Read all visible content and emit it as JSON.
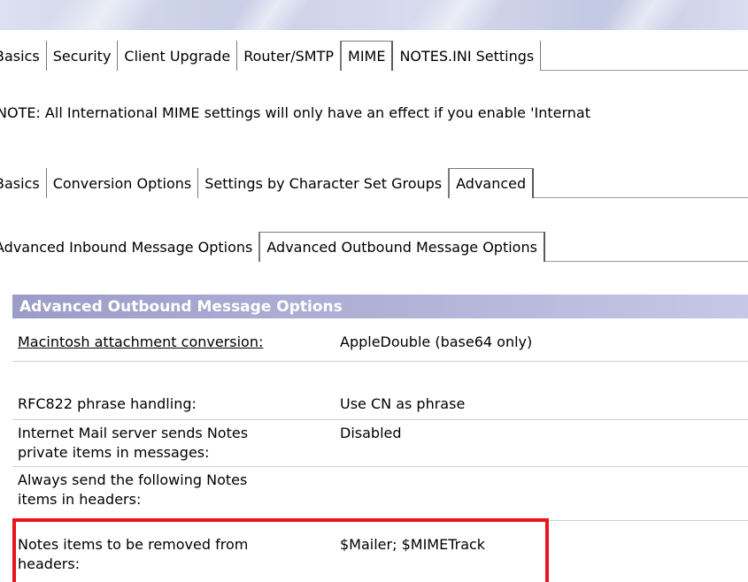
{
  "top_tabs": [
    {
      "label": "Basics",
      "active": false
    },
    {
      "label": "Security",
      "active": false
    },
    {
      "label": "Client Upgrade",
      "active": false
    },
    {
      "label": "Router/SMTP",
      "active": false
    },
    {
      "label": "MIME",
      "active": true
    },
    {
      "label": "NOTES.INI Settings",
      "active": false
    }
  ],
  "note": "NOTE: All International MIME settings will only have an effect if you enable 'Internat",
  "mime_tabs": [
    {
      "label": "Basics",
      "active": false
    },
    {
      "label": "Conversion Options",
      "active": false
    },
    {
      "label": "Settings by Character Set Groups",
      "active": false
    },
    {
      "label": "Advanced",
      "active": true
    }
  ],
  "advanced_tabs": [
    {
      "label": "Advanced Inbound Message Options",
      "active": false
    },
    {
      "label": "Advanced Outbound Message Options",
      "active": true
    }
  ],
  "section": {
    "title": "Advanced Outbound Message Options"
  },
  "fields": {
    "mac_attach": {
      "label": "Macintosh attachment conversion:",
      "value": "AppleDouble (base64 only)"
    },
    "rfc822": {
      "label": "RFC822 phrase handling:",
      "value": "Use CN as phrase"
    },
    "private_items": {
      "label": "Internet Mail server sends Notes private items in messages:",
      "value": "Disabled"
    },
    "always_send": {
      "label": "Always send the following Notes items in headers:",
      "value": ""
    },
    "removed_items": {
      "label": "Notes items to be removed from headers:",
      "value": "$Mailer; $MIMETrack"
    }
  },
  "colors": {
    "section_header": "#9c9cc9",
    "highlight_box": "#e8141e"
  }
}
